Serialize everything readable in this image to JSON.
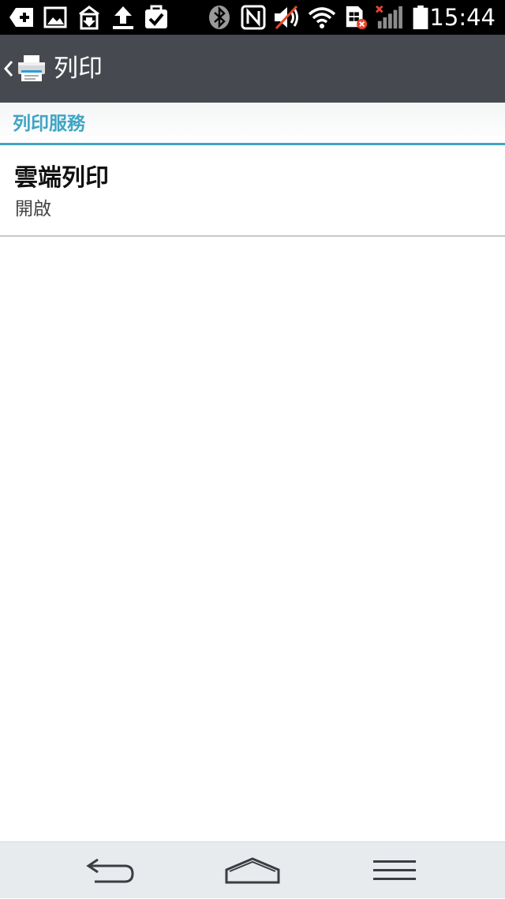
{
  "status_bar": {
    "time": "15:44",
    "notification_icons": [
      "add-icon",
      "gallery-icon",
      "download-icon",
      "upload-icon",
      "task-done-icon"
    ],
    "system_icons": [
      "bluetooth-icon",
      "nfc-icon",
      "mute-icon",
      "wifi-icon",
      "sim-error-icon",
      "signal-icon",
      "battery-icon"
    ]
  },
  "action_bar": {
    "title": "列印",
    "icon": "printer-icon"
  },
  "section": {
    "title": "列印服務"
  },
  "items": [
    {
      "title": "雲端列印",
      "summary": "開啟"
    }
  ],
  "nav_bar": {
    "buttons": [
      "back-icon",
      "home-icon",
      "menu-icon"
    ]
  },
  "colors": {
    "accent": "#3fa5c4",
    "action_bar": "#464a50",
    "status_bar": "#000000",
    "nav_bar": "#e8ebee"
  }
}
